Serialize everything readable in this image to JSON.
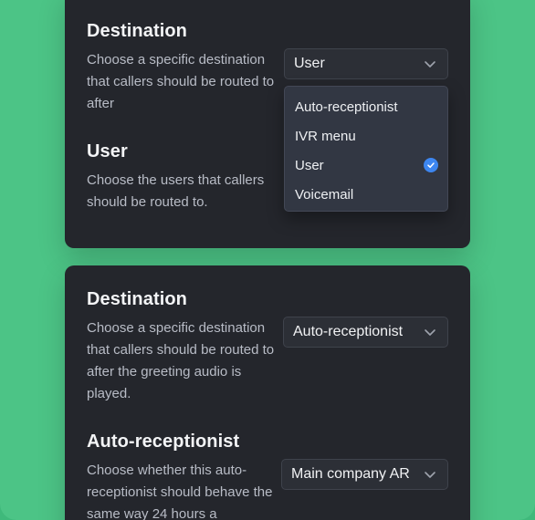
{
  "top_card": {
    "destination": {
      "title": "Destination",
      "description": "Choose a specific destination that callers should be routed to after",
      "selected": "User"
    },
    "user": {
      "title": "User",
      "description": "Choose the users that callers should be routed to."
    },
    "dropdown": {
      "options": [
        {
          "label": "Auto-receptionist",
          "selected": false
        },
        {
          "label": "IVR menu",
          "selected": false
        },
        {
          "label": "User",
          "selected": true
        },
        {
          "label": "Voicemail",
          "selected": false
        }
      ]
    }
  },
  "bottom_card": {
    "destination": {
      "title": "Destination",
      "description": "Choose a specific destination that callers should be routed to after the greeting audio is played.",
      "selected": "Auto-receptionist"
    },
    "auto_receptionist": {
      "title": "Auto-receptionist",
      "description": "Choose whether this auto-receptionist should behave the same way 24 hours a",
      "selected": "Main company AR"
    }
  },
  "colors": {
    "background": "#4CC486",
    "card": "#24262C",
    "select": "#2C2F36",
    "dropdown": "#323743",
    "accent": "#3D86F0"
  },
  "icons": {
    "select_arrow": "chevron-down-icon",
    "selected_mark": "check-circle-icon"
  }
}
